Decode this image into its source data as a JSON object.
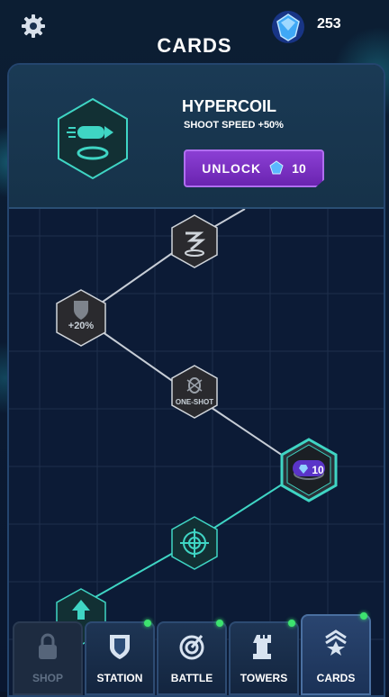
{
  "header": {
    "title": "CARDS",
    "gems": "253"
  },
  "detail": {
    "name": "HYPERCOIL",
    "description": "SHOOT SPEED +50%",
    "unlock_label": "UNLOCK",
    "unlock_cost": "10",
    "accent_color": "#8b3fd4"
  },
  "tree": {
    "nodes": [
      {
        "label": "",
        "icon": "speed-coil-icon"
      },
      {
        "label": "+20%",
        "icon": "shield-icon"
      },
      {
        "label": "ONE-SHOT",
        "icon": "bug-icon"
      },
      {
        "label": "10",
        "icon": "gem-icon",
        "selected": true
      },
      {
        "label": "",
        "icon": "target-icon"
      },
      {
        "label": "",
        "icon": "arrow-up-icon"
      }
    ]
  },
  "nav": {
    "tabs": [
      {
        "label": "SHOP",
        "icon": "lock-icon",
        "state": "disabled"
      },
      {
        "label": "STATION",
        "icon": "shield-icon",
        "notify": true
      },
      {
        "label": "BATTLE",
        "icon": "target-icon",
        "notify": true
      },
      {
        "label": "TOWERS",
        "icon": "tower-icon",
        "notify": true
      },
      {
        "label": "CARDS",
        "icon": "cards-icon",
        "state": "active",
        "notify": true
      }
    ]
  }
}
